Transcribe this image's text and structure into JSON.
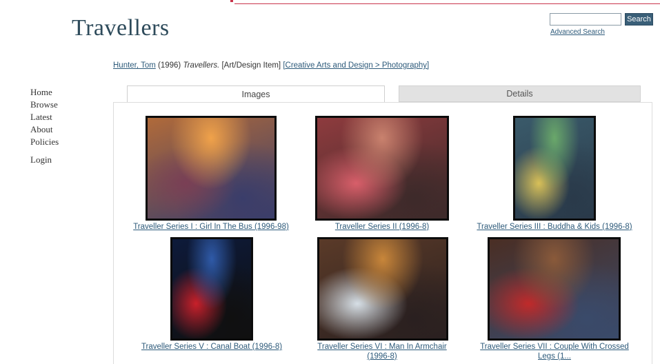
{
  "header": {
    "title": "Travellers",
    "search_value": "",
    "search_button": "Search",
    "advanced_search": "Advanced Search"
  },
  "citation": {
    "author": "Hunter, Tom",
    "year": "(1996)",
    "title": "Travellers.",
    "type": "[Art/Design Item]",
    "subject": "[Creative Arts and Design > Photography]"
  },
  "nav": {
    "home": "Home",
    "browse": "Browse",
    "latest": "Latest",
    "about": "About",
    "policies": "Policies",
    "login": "Login"
  },
  "tabs": {
    "images": "Images",
    "details": "Details"
  },
  "gallery": [
    {
      "caption": "Traveller Series I : Girl In The Bus (1996-98)",
      "colors": [
        "#b06a3a",
        "#f0a24a",
        "#7a3f55",
        "#3a3d6a"
      ]
    },
    {
      "caption": "Traveller Series II (1996-8)",
      "colors": [
        "#8e3b3e",
        "#c9826e",
        "#d85f6a",
        "#3d2a2a"
      ]
    },
    {
      "caption": "Traveller Series III : Buddha & Kids (1996-8)",
      "colors": [
        "#3a5a6a",
        "#6aa86a",
        "#d8c058",
        "#2a3a4a"
      ]
    },
    {
      "caption": "Traveller Series V : Canal Boat (1996-8)",
      "colors": [
        "#0d1a3a",
        "#2f5aa8",
        "#c8202a",
        "#101010"
      ]
    },
    {
      "caption": "Traveller Series VI : Man In Armchair (1996-8)",
      "colors": [
        "#5a3a28",
        "#c8863a",
        "#d6dfe6",
        "#2a2020"
      ]
    },
    {
      "caption": "Traveller Series VII : Couple With Crossed Legs (1...",
      "colors": [
        "#4a2e24",
        "#8a5a3a",
        "#c02a2a",
        "#3a4a6a"
      ]
    }
  ]
}
